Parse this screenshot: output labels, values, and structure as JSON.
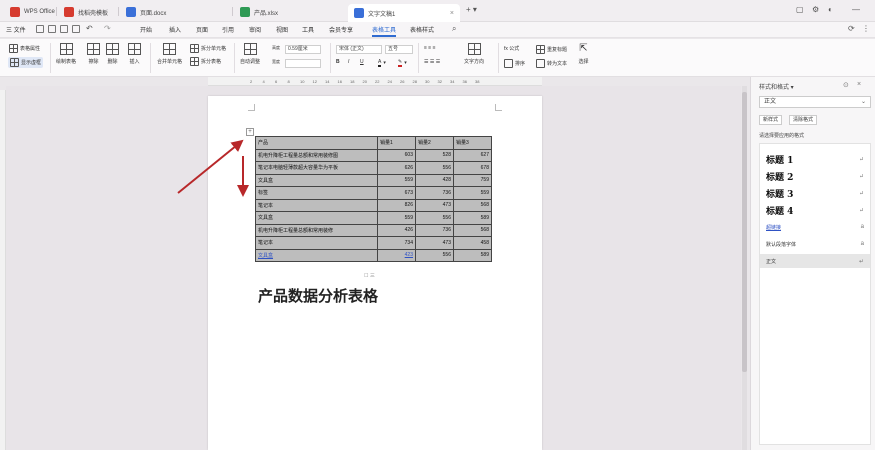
{
  "tabs": [
    {
      "label": "WPS Office",
      "color": "#d63b2f"
    },
    {
      "label": "找稻壳模板",
      "color": "#d63b2f"
    },
    {
      "label": "页面.docx",
      "color": "#3a6fd8"
    },
    {
      "label": "产品.xlsx",
      "color": "#2f9a55"
    },
    {
      "label": "文字文稿1",
      "color": "#3a6fd8"
    }
  ],
  "menu": {
    "file": "三 文件",
    "items": [
      "开始",
      "插入",
      "页面",
      "引用",
      "审阅",
      "视图",
      "工具",
      "会员专享",
      "表格工具",
      "表格样式"
    ],
    "active": "表格工具"
  },
  "ribbon": {
    "table_props": "表格属性",
    "show_gridlines": "显示虚框",
    "draw_table": "绘制表格",
    "eraser": "擦除",
    "delete": "删除",
    "insert": "插入",
    "merge_cells": "合并单元格",
    "split_cells": "拆分单元格",
    "split_table": "拆分表格",
    "auto_fit": "自动调整",
    "height_label": "高度",
    "width_label": "宽度",
    "font_name": "宋体 (正文)",
    "font_size": "五号",
    "text_direction": "文字方向",
    "formula": "fx 公式",
    "repeat_header": "重复标题",
    "sort": "排序",
    "convert_text": "转为文本",
    "select": "选择"
  },
  "ruler": [
    "2",
    "4",
    "6",
    "8",
    "10",
    "12",
    "14",
    "16",
    "18",
    "20",
    "22",
    "24",
    "26",
    "28",
    "30",
    "32",
    "34",
    "36",
    "38"
  ],
  "table": {
    "header": [
      "产品",
      "销量1",
      "销量2",
      "销量3"
    ],
    "rows": [
      [
        "机电升降柜工程量总额和常用装修图",
        "603",
        "528",
        "627"
      ],
      [
        "笔记本电脑轻薄款超大容量华为平板",
        "626",
        "556",
        "678"
      ],
      [
        "文具盒",
        "559",
        "428",
        "759"
      ],
      [
        "标签",
        "673",
        "736",
        "559"
      ],
      [
        "笔记本",
        "826",
        "473",
        "568"
      ],
      [
        "文具盒",
        "559",
        "556",
        "589"
      ],
      [
        "机电升降柜工程量总额和常用装修",
        "426",
        "736",
        "568"
      ],
      [
        "笔记本",
        "734",
        "473",
        "458"
      ],
      [
        "文具盒",
        "423",
        "556",
        "589"
      ]
    ]
  },
  "doc_title": "产品数据分析表格",
  "add_row_label": "☐ 三",
  "panel": {
    "title": "样式和格式 ▾",
    "current_style": "正文",
    "new_style": "新样式",
    "clear_format": "清除格式",
    "subtitle": "请选择要应用的格式",
    "styles": [
      {
        "label": "标题 1",
        "mark": "↵",
        "kind": "h"
      },
      {
        "label": "标题 2",
        "mark": "↵",
        "kind": "h"
      },
      {
        "label": "标题 3",
        "mark": "↵",
        "kind": "h"
      },
      {
        "label": "标题 4",
        "mark": "↵",
        "kind": "h"
      },
      {
        "label": "超链接",
        "mark": "a",
        "kind": "link"
      },
      {
        "label": "默认段落字体",
        "mark": "a",
        "kind": "plain"
      },
      {
        "label": "正文",
        "mark": "↵",
        "kind": "plain",
        "selected": true
      }
    ]
  },
  "colors": {
    "accent": "#2f6bd1",
    "arrow": "#b8282a",
    "table_fill": "#bdbdbd"
  }
}
